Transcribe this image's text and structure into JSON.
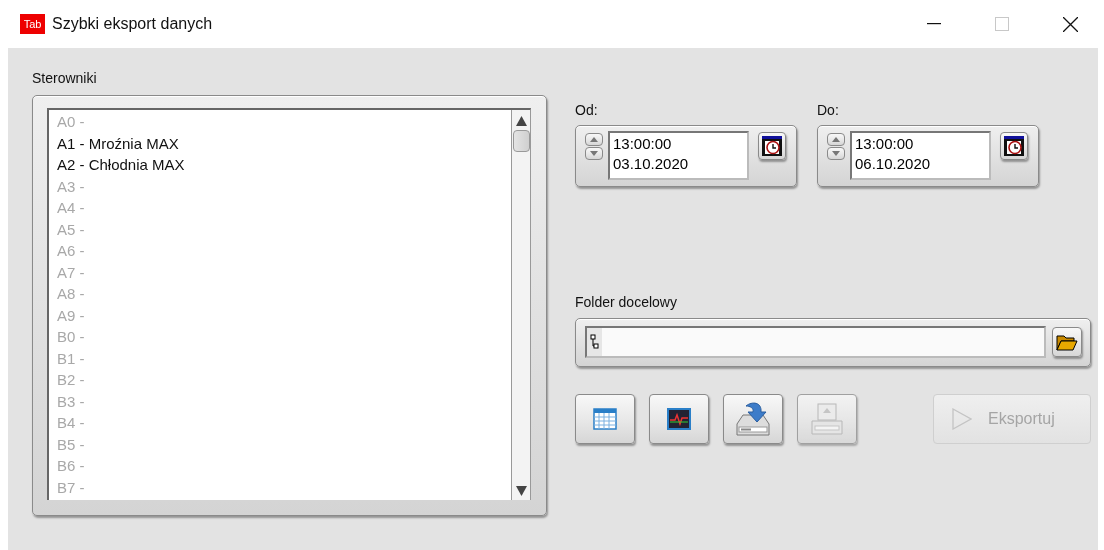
{
  "window": {
    "app_icon_text": "Tab",
    "title": "Szybki eksport danych",
    "controls": [
      {
        "kind": "minimize",
        "disabled": false
      },
      {
        "kind": "maximize",
        "disabled": true
      },
      {
        "kind": "close",
        "disabled": false
      }
    ]
  },
  "controllers": {
    "label": "Sterowniki",
    "items": [
      {
        "text": "A0 -",
        "disabled": true
      },
      {
        "text": "A1 - Mroźnia MAX",
        "disabled": false
      },
      {
        "text": "A2 - Chłodnia MAX",
        "disabled": false
      },
      {
        "text": "A3 -",
        "disabled": true
      },
      {
        "text": "A4 -",
        "disabled": true
      },
      {
        "text": "A5 -",
        "disabled": true
      },
      {
        "text": "A6 -",
        "disabled": true
      },
      {
        "text": "A7 -",
        "disabled": true
      },
      {
        "text": "A8 -",
        "disabled": true
      },
      {
        "text": "A9 -",
        "disabled": true
      },
      {
        "text": "B0 -",
        "disabled": true
      },
      {
        "text": "B1 -",
        "disabled": true
      },
      {
        "text": "B2 -",
        "disabled": true
      },
      {
        "text": "B3 -",
        "disabled": true
      },
      {
        "text": "B4 -",
        "disabled": true
      },
      {
        "text": "B5 -",
        "disabled": true
      },
      {
        "text": "B6 -",
        "disabled": true
      },
      {
        "text": "B7 -",
        "disabled": true
      }
    ]
  },
  "range": [
    {
      "label": "Od:",
      "time": "13:00:00",
      "date": "03.10.2020"
    },
    {
      "label": "Do:",
      "time": "13:00:00",
      "date": "06.10.2020"
    }
  ],
  "destination": {
    "label": "Folder docelowy"
  },
  "toolbar": [
    {
      "kind": "table",
      "disabled": false
    },
    {
      "kind": "chart",
      "disabled": false
    },
    {
      "kind": "import",
      "disabled": false
    },
    {
      "kind": "tray",
      "disabled": true
    }
  ],
  "export_button": {
    "label": "Eksportuj",
    "disabled": true
  }
}
